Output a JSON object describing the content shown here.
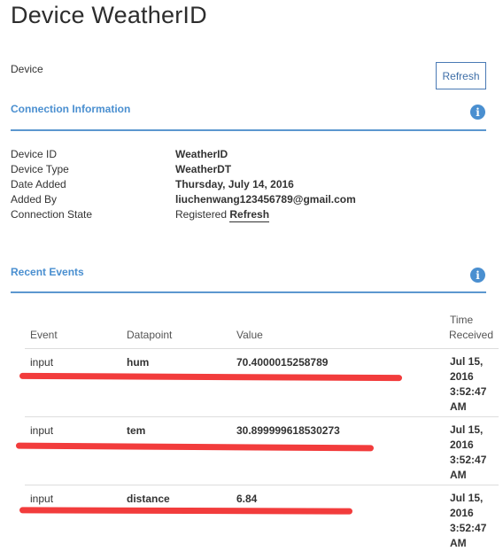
{
  "page": {
    "title": "Device WeatherID"
  },
  "header": {
    "device_label": "Device",
    "refresh_label": "Refresh"
  },
  "connection": {
    "section_title": "Connection Information",
    "fields": [
      {
        "label": "Device ID",
        "value": "WeatherID"
      },
      {
        "label": "Device Type",
        "value": "WeatherDT"
      },
      {
        "label": "Date Added",
        "value": "Thursday, July 14, 2016"
      },
      {
        "label": "Added By",
        "value": "liuchenwang123456789@gmail.com"
      },
      {
        "label": "Connection State",
        "value": "Registered",
        "link": "Refresh"
      }
    ]
  },
  "events": {
    "section_title": "Recent Events",
    "columns": {
      "event": "Event",
      "datapoint": "Datapoint",
      "value": "Value",
      "time_line1": "Time",
      "time_line2": "Received"
    },
    "rows": [
      {
        "event": "input",
        "datapoint": "hum",
        "value": "70.4000015258789",
        "time": [
          "Jul 15,",
          "2016",
          "3:52:47",
          "AM"
        ]
      },
      {
        "event": "input",
        "datapoint": "tem",
        "value": "30.899999618530273",
        "time": [
          "Jul 15,",
          "2016",
          "3:52:47",
          "AM"
        ]
      },
      {
        "event": "input",
        "datapoint": "distance",
        "value": "6.84",
        "time": [
          "Jul 15,",
          "2016",
          "3:52:47",
          "AM"
        ]
      }
    ]
  },
  "icons": {
    "info": "info-circle-icon"
  },
  "colors": {
    "accent": "#4a8fd0",
    "annotation": "#f23c3c"
  }
}
